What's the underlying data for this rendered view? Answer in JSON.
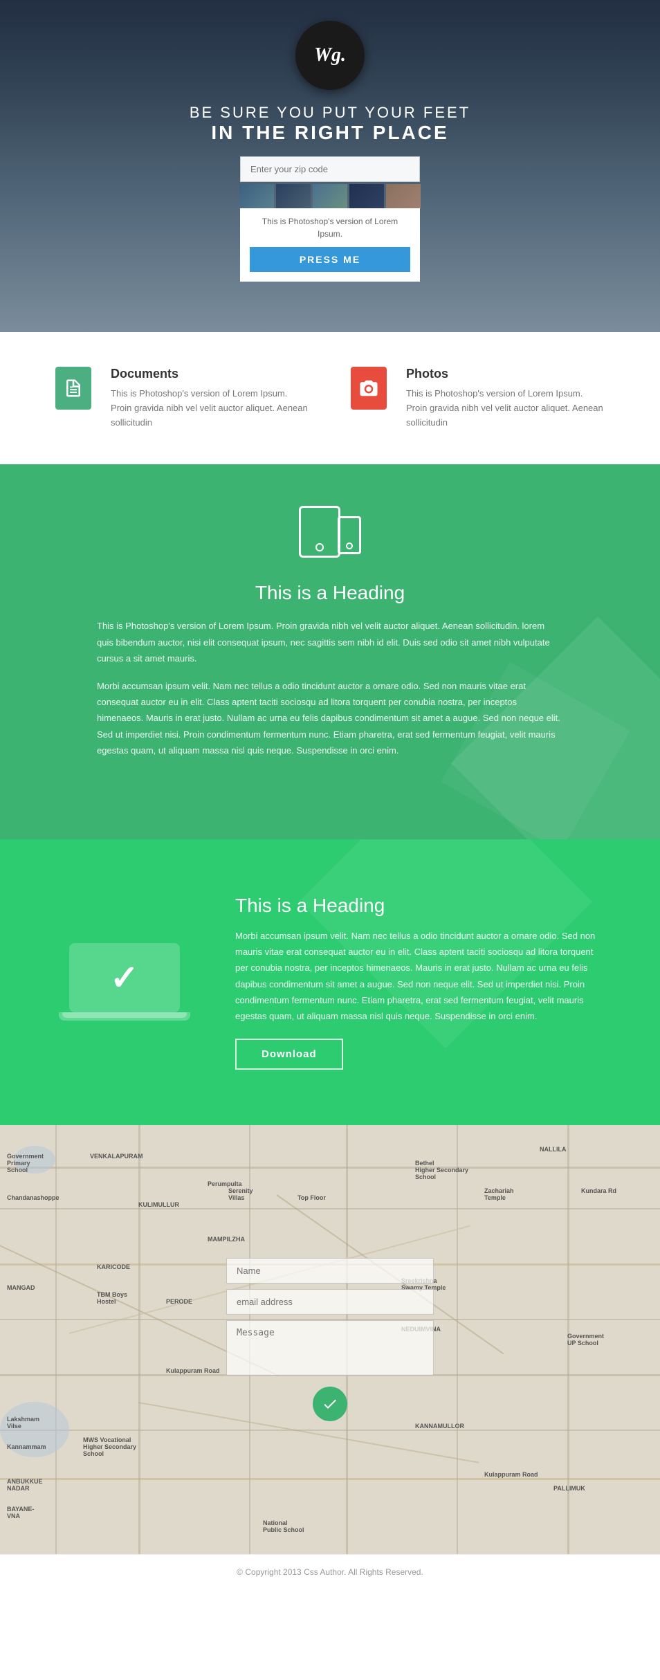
{
  "logo": {
    "text": "Wg.",
    "aria": "Logo"
  },
  "hero": {
    "tagline_line1": "BE SURE YOU PUT YOUR FEET",
    "tagline_line2": "IN THE RIGHT PLACE",
    "search_placeholder": "Enter your zip code",
    "card_text": "This is Photoshop's version  of Lorem Ipsum.",
    "btn_label": "PRESS ME"
  },
  "features": [
    {
      "icon": "document",
      "title": "Documents",
      "body": "This is Photoshop's version  of Lorem Ipsum. Proin gravida nibh vel velit auctor aliquet. Aenean sollicitudin"
    },
    {
      "icon": "camera",
      "title": "Photos",
      "body": "This is Photoshop's version  of Lorem Ipsum. Proin gravida nibh vel velit auctor aliquet. Aenean sollicitudin"
    }
  ],
  "green_section1": {
    "heading": "This is a Heading",
    "para1": "This is Photoshop's version  of Lorem Ipsum. Proin gravida nibh vel velit auctor aliquet. Aenean sollicitudin. lorem quis bibendum auctor, nisi elit consequat ipsum, nec sagittis sem nibh id elit. Duis sed odio sit amet nibh vulputate cursus a sit amet mauris.",
    "para2": "Morbi accumsan ipsum velit. Nam nec tellus a odio tincidunt auctor a ornare odio. Sed non  mauris vitae erat consequat auctor eu in elit. Class aptent taciti sociosqu ad litora torquent per conubia nostra, per inceptos himenaeos. Mauris in erat justo. Nullam ac urna eu felis dapibus condimentum sit amet a augue. Sed non neque elit. Sed ut imperdiet nisi. Proin condimentum fermentum nunc. Etiam pharetra, erat sed fermentum feugiat, velit mauris egestas quam, ut aliquam massa nisl quis neque. Suspendisse in orci enim."
  },
  "green_section2": {
    "heading": "This is a Heading",
    "body": "Morbi accumsan ipsum velit. Nam nec tellus a odio tincidunt auctor a ornare odio. Sed non  mauris vitae erat consequat auctor eu in elit. Class aptent taciti sociosqu ad litora torquent per conubia nostra, per inceptos himenaeos. Mauris in erat justo. Nullam ac urna eu felis dapibus condimentum sit amet a augue. Sed non neque elit. Sed ut imperdiet nisi. Proin condimentum fermentum nunc. Etiam pharetra, erat sed fermentum feugiat, velit mauris egestas quam, ut aliquam massa nisl quis neque. Suspendisse in orci enim.",
    "download_btn": "Download"
  },
  "contact": {
    "name_placeholder": "Name",
    "email_placeholder": "email address",
    "message_placeholder": "Message"
  },
  "footer": {
    "copyright": "© Copyright 2013 Css Author. All Rights Reserved."
  },
  "colors": {
    "green1": "#3cb371",
    "green2": "#2ecc71",
    "blue_btn": "#3498db",
    "red_icon": "#e74c3c",
    "doc_icon": "#4caf82"
  }
}
